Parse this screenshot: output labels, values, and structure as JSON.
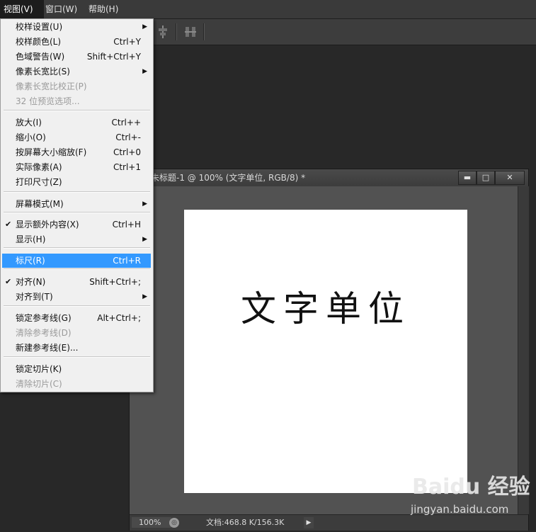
{
  "menubar": {
    "items": [
      "视图(V)",
      "窗口(W)",
      "帮助(H)"
    ]
  },
  "document": {
    "title": "未标题-1 @ 100% (文字单位, RGB/8) *",
    "canvas_text": "文字单位",
    "window_buttons": {
      "minimize": "▬",
      "maximize": "□",
      "close": "✕"
    }
  },
  "statusbar": {
    "zoom": "100%",
    "doc_info": "文档:468.8 K/156.3K"
  },
  "view_menu": {
    "items": [
      {
        "label": "校样设置(U)",
        "shortcut": "",
        "submenu": true
      },
      {
        "label": "校样颜色(L)",
        "shortcut": "Ctrl+Y"
      },
      {
        "label": "色域警告(W)",
        "shortcut": "Shift+Ctrl+Y"
      },
      {
        "label": "像素长宽比(S)",
        "shortcut": "",
        "submenu": true
      },
      {
        "label": "像素长宽比校正(P)",
        "shortcut": "",
        "disabled": true
      },
      {
        "label": "32 位预览选项...",
        "shortcut": "",
        "disabled": true
      },
      {
        "label": "放大(I)",
        "shortcut": "Ctrl++"
      },
      {
        "label": "缩小(O)",
        "shortcut": "Ctrl+-"
      },
      {
        "label": "按屏幕大小缩放(F)",
        "shortcut": "Ctrl+0"
      },
      {
        "label": "实际像素(A)",
        "shortcut": "Ctrl+1"
      },
      {
        "label": "打印尺寸(Z)",
        "shortcut": ""
      },
      {
        "label": "屏幕模式(M)",
        "shortcut": "",
        "submenu": true
      },
      {
        "label": "显示额外内容(X)",
        "shortcut": "Ctrl+H",
        "checked": true
      },
      {
        "label": "显示(H)",
        "shortcut": "",
        "submenu": true
      },
      {
        "label": "标尺(R)",
        "shortcut": "Ctrl+R",
        "highlighted": true
      },
      {
        "label": "对齐(N)",
        "shortcut": "Shift+Ctrl+;",
        "checked": true
      },
      {
        "label": "对齐到(T)",
        "shortcut": "",
        "submenu": true
      },
      {
        "label": "锁定参考线(G)",
        "shortcut": "Alt+Ctrl+;"
      },
      {
        "label": "清除参考线(D)",
        "shortcut": "",
        "disabled": true
      },
      {
        "label": "新建参考线(E)...",
        "shortcut": ""
      },
      {
        "label": "锁定切片(K)",
        "shortcut": ""
      },
      {
        "label": "清除切片(C)",
        "shortcut": "",
        "disabled": true
      }
    ],
    "check_glyph": "✔",
    "submenu_glyph": "▶"
  },
  "watermark": {
    "logo": "Baidu 经验",
    "url": "jingyan.baidu.com"
  },
  "colors": {
    "menu_highlight": "#3399ff",
    "workspace": "#282828",
    "canvas": "#ffffff"
  }
}
